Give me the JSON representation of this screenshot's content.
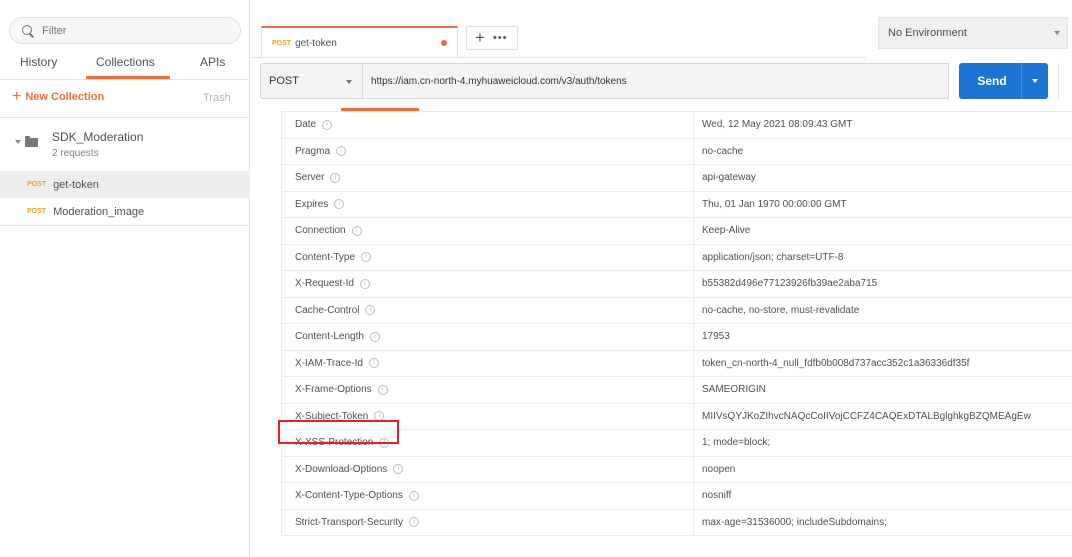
{
  "sidebar": {
    "filter_placeholder": "Filter",
    "tabs": {
      "history": "History",
      "collections": "Collections",
      "apis": "APIs"
    },
    "new_collection": "New Collection",
    "trash": "Trash",
    "collection": {
      "name": "SDK_Moderation",
      "count": "2 requests"
    },
    "requests": [
      {
        "method": "POST",
        "name": "get-token"
      },
      {
        "method": "POST",
        "name": "Moderation_image"
      }
    ]
  },
  "tabbar": {
    "active_tab": {
      "method": "POST",
      "name": "get-token"
    },
    "add_tab": "+",
    "more": "•••"
  },
  "environment": {
    "selected": "No Environment"
  },
  "request": {
    "method": "POST",
    "url": "https://iam.cn-north-4.myhuaweicloud.com/v3/auth/tokens",
    "send_label": "Send"
  },
  "headers": [
    {
      "key": "Date",
      "value": "Wed, 12 May 2021 08:09:43 GMT"
    },
    {
      "key": "Pragma",
      "value": "no-cache"
    },
    {
      "key": "Server",
      "value": "api-gateway"
    },
    {
      "key": "Expires",
      "value": "Thu, 01 Jan 1970 00:00:00 GMT"
    },
    {
      "key": "Connection",
      "value": "Keep-Alive"
    },
    {
      "key": "Content-Type",
      "value": "application/json; charset=UTF-8"
    },
    {
      "key": "X-Request-Id",
      "value": "b55382d496e77123926fb39ae2aba715"
    },
    {
      "key": "Cache-Control",
      "value": "no-cache, no-store, must-revalidate"
    },
    {
      "key": "Content-Length",
      "value": "17953"
    },
    {
      "key": "X-IAM-Trace-Id",
      "value": "token_cn-north-4_null_fdfb0b008d737acc352c1a36336df35f"
    },
    {
      "key": "X-Frame-Options",
      "value": "SAMEORIGIN"
    },
    {
      "key": "X-Subject-Token",
      "value": "MIIVsQYJKoZIhvcNAQcCoIIVojCCFZ4CAQExDTALBglghkgBZQMEAgEw"
    },
    {
      "key": "X-XSS-Protection",
      "value": "1; mode=block;"
    },
    {
      "key": "X-Download-Options",
      "value": "noopen"
    },
    {
      "key": "X-Content-Type-Options",
      "value": "nosniff"
    },
    {
      "key": "Strict-Transport-Security",
      "value": "max-age=31536000; includeSubdomains;"
    }
  ],
  "colors": {
    "accent": "#f26b3a",
    "send": "#1a75d2",
    "highlight": "#e0222a",
    "method": "#e8a32a"
  }
}
